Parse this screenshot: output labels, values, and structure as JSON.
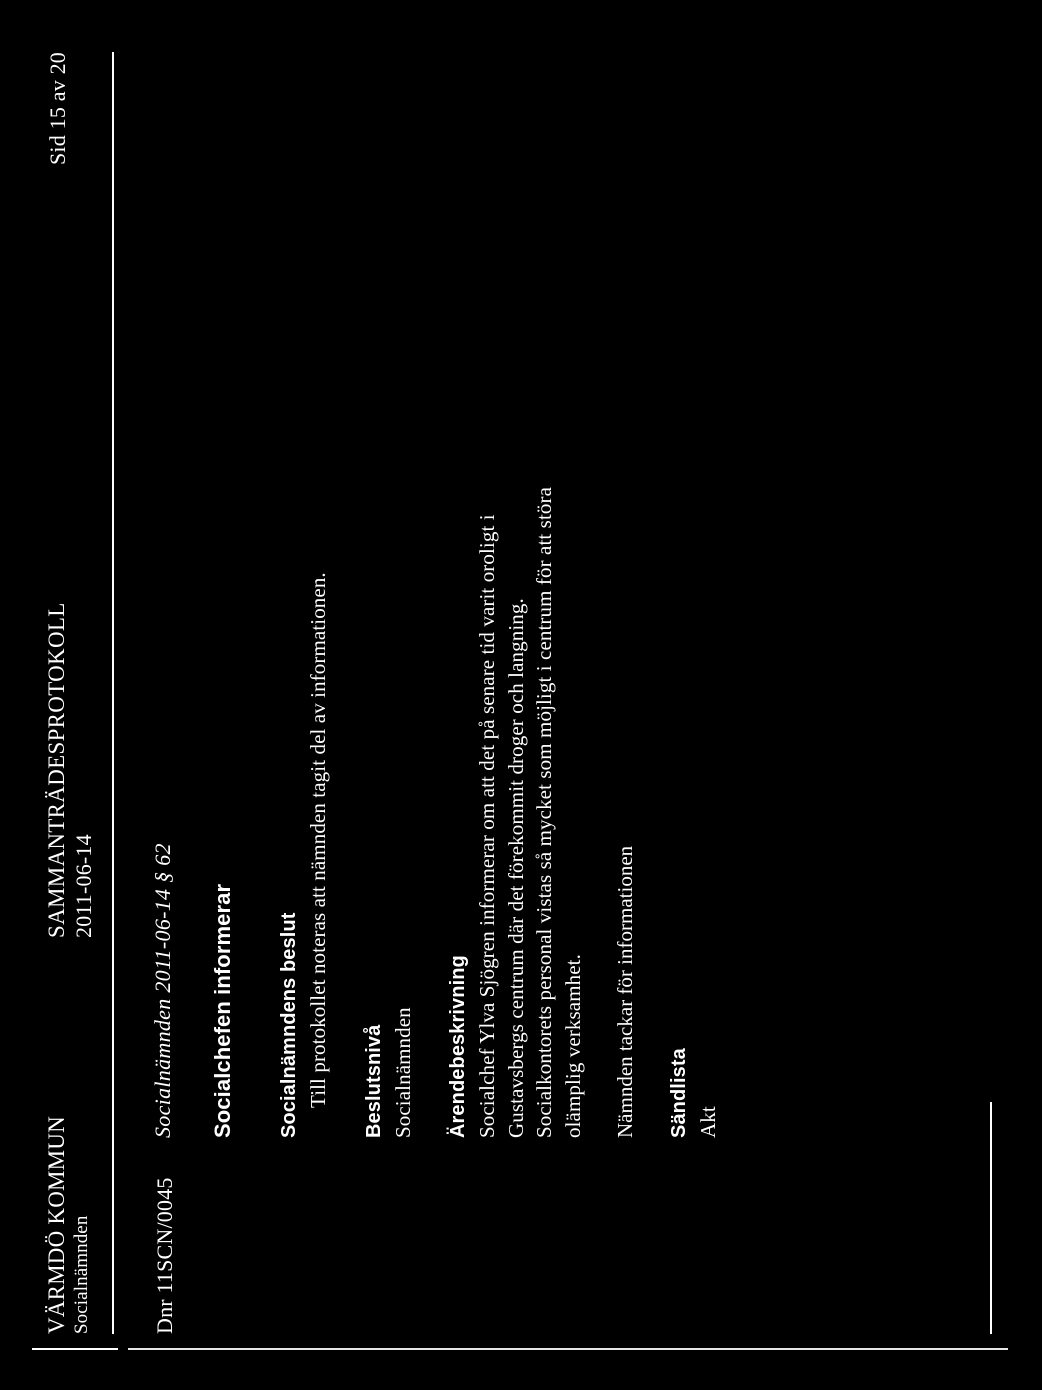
{
  "document": {
    "header": {
      "organization": "VÄRMDÖ KOMMUN",
      "board": "Socialnämnden",
      "doc_type": "SAMMANTRÄDESPROTOKOLL",
      "date": "2011-06-14",
      "page_label": "Sid 15 av 20"
    },
    "case": {
      "dnr": "Dnr 11SCN/0045",
      "reference": "Socialnämnden 2011-06-14 § 62",
      "title": "Socialchefen informerar"
    },
    "sections": [
      {
        "heading": "Socialnämndens beslut",
        "lines": [
          "Till protokollet noteras att nämnden tagit del av informationen."
        ]
      },
      {
        "heading": "Beslutsnivå",
        "lines": [
          "Socialnämnden"
        ]
      },
      {
        "heading": "Ärendebeskrivning",
        "lines": [
          "Socialchef Ylva Sjögren informerar om att det på senare tid varit oroligt i",
          "Gustavsbergs centrum där det förekommit droger och langning.",
          "Socialkontorets personal vistas så mycket som möjligt i centrum för att störa",
          "olämplig verksamhet."
        ]
      }
    ],
    "closing": "Nämnden tackar för informationen",
    "distribution": {
      "heading": "Sändlista",
      "items": [
        "Akt"
      ]
    }
  }
}
